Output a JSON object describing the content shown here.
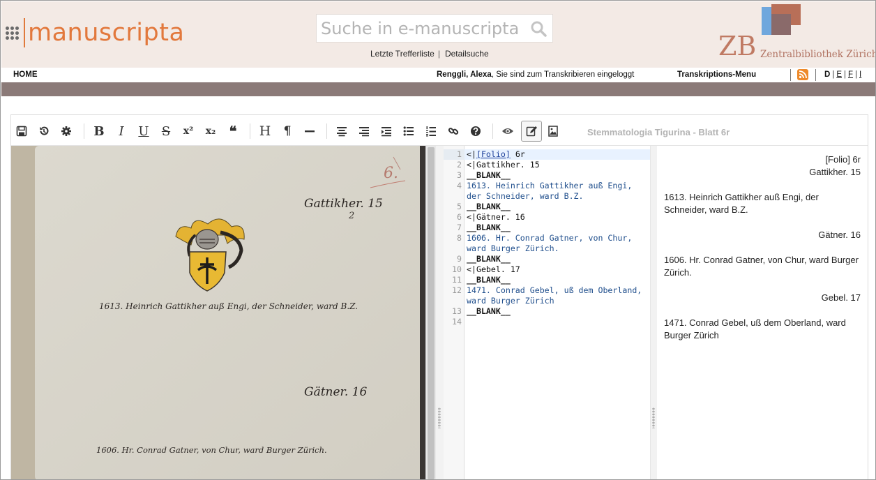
{
  "header": {
    "logo_text": "manuscripta",
    "search_placeholder": "Suche in e-manuscripta",
    "link_last_results": "Letzte Trefferliste",
    "link_separator": "|",
    "link_detail_search": "Detailsuche",
    "partner_logo_letters": "ZB",
    "partner_name": "Zentralbibliothek Zürich",
    "accent_color": "#e2783c"
  },
  "nav": {
    "home": "HOME",
    "user_name": "Renggli, Alexa",
    "login_status": ", Sie sind zum Transkribieren eingeloggt",
    "menu": "Transkriptions-Menu",
    "languages": [
      "D",
      "E",
      "F",
      "I"
    ],
    "separator": "|"
  },
  "toolbar": {
    "document_title": "Stemmatologia Tigurina - Blatt 6r",
    "icons": [
      "save-icon",
      "undo-icon",
      "gear-icon",
      "bold-icon",
      "italic-icon",
      "underline-icon",
      "strikethrough-icon",
      "superscript-icon",
      "subscript-icon",
      "quote-icon",
      "heading-icon",
      "paragraph-icon",
      "horizontal-rule-icon",
      "align-center-icon",
      "align-right-icon",
      "indent-icon",
      "bullet-list-icon",
      "numbered-list-icon",
      "link-icon",
      "help-icon",
      "eye-icon",
      "edit-icon",
      "image-icon"
    ],
    "bold_glyph": "B",
    "italic_glyph": "I",
    "underline_glyph": "U",
    "strike_glyph": "S",
    "superscript_glyph": "x²",
    "subscript_glyph": "x₂",
    "quote_glyph": "❝",
    "heading_glyph": "H",
    "paragraph_glyph": "¶"
  },
  "image": {
    "folio_mark": "6.",
    "script_1": "Gattikher. 15",
    "script_1_sub": "2",
    "script_2": "1613. Heinrich Gattikher auß Engi, der Schneider, ward B.Z.",
    "script_3": "Gätner. 16",
    "script_4": "1606. Hr. Conrad Gatner, von Chur, ward Burger Zürich."
  },
  "code_lines": [
    {
      "n": "1",
      "parts": [
        {
          "t": "<|",
          "c": ""
        },
        {
          "t": "[Folio]",
          "c": "link"
        },
        {
          "t": " 6r",
          "c": ""
        }
      ]
    },
    {
      "n": "2",
      "parts": [
        {
          "t": "<|Gattikher. 15",
          "c": ""
        }
      ]
    },
    {
      "n": "3",
      "parts": [
        {
          "t": "__BLANK__",
          "c": "blank"
        }
      ]
    },
    {
      "n": "4",
      "parts": [
        {
          "t": "1613. Heinrich Gattikher auß Engi,",
          "c": "blue"
        }
      ]
    },
    {
      "n": "",
      "parts": [
        {
          "t": "der Schneider, ward B.Z.",
          "c": "blue"
        }
      ]
    },
    {
      "n": "5",
      "parts": [
        {
          "t": "__BLANK__",
          "c": "blank"
        }
      ]
    },
    {
      "n": "6",
      "parts": [
        {
          "t": "<|Gätner. 16",
          "c": ""
        }
      ]
    },
    {
      "n": "7",
      "parts": [
        {
          "t": "__BLANK__",
          "c": "blank"
        }
      ]
    },
    {
      "n": "8",
      "parts": [
        {
          "t": "1606. Hr. Conrad Gatner, von Chur,",
          "c": "blue"
        }
      ]
    },
    {
      "n": "",
      "parts": [
        {
          "t": "ward Burger Zürich.",
          "c": "blue"
        }
      ]
    },
    {
      "n": "9",
      "parts": [
        {
          "t": "__BLANK__",
          "c": "blank"
        }
      ]
    },
    {
      "n": "10",
      "parts": [
        {
          "t": "<|Gebel. 17",
          "c": ""
        }
      ]
    },
    {
      "n": "11",
      "parts": [
        {
          "t": "__BLANK__",
          "c": "blank"
        }
      ]
    },
    {
      "n": "12",
      "parts": [
        {
          "t": "1471. Conrad Gebel, uß dem Oberland,",
          "c": "blue"
        }
      ]
    },
    {
      "n": "",
      "parts": [
        {
          "t": "ward Burger Zürich",
          "c": "blue"
        }
      ]
    },
    {
      "n": "13",
      "parts": [
        {
          "t": "__BLANK__",
          "c": "blank"
        }
      ]
    },
    {
      "n": "14",
      "parts": []
    }
  ],
  "preview": {
    "folio": "[Folio] 6r",
    "heading_1": "Gattikher. 15",
    "entry_1": "1613. Heinrich Gattikher auß Engi, der Schneider, ward B.Z.",
    "heading_2": "Gätner. 16",
    "entry_2": "1606. Hr. Conrad Gatner, von Chur, ward Burger Zürich.",
    "heading_3": "Gebel. 17",
    "entry_3": "1471. Conrad Gebel, uß dem Oberland, ward Burger Zürich"
  }
}
